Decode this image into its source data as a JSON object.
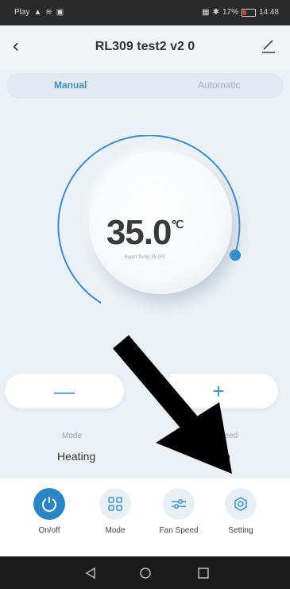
{
  "status_bar": {
    "left_text": "Play",
    "right_battery": "17%",
    "time": "14:48"
  },
  "header": {
    "title": "RL309 test2 v2 0"
  },
  "tabs": [
    {
      "label": "Manual"
    },
    {
      "label": "Automatic"
    }
  ],
  "dial": {
    "temperature": "35.0",
    "unit": "℃",
    "room_temp": "Room Temp 25.0℃"
  },
  "controls": {
    "minus": "—",
    "plus": "+"
  },
  "info": {
    "mode_label": "Mode",
    "mode_value": "Heating",
    "fan_label": "peed",
    "fan_value": "to"
  },
  "bottom_nav": [
    {
      "label": "On/off",
      "icon": "power-icon"
    },
    {
      "label": "Mode",
      "icon": "grid-icon"
    },
    {
      "label": "Fan Speed",
      "icon": "sliders-icon"
    },
    {
      "label": "Setting",
      "icon": "settings-icon"
    }
  ],
  "colors": {
    "accent": "#2f8fd0",
    "power": "#2a86c2"
  }
}
